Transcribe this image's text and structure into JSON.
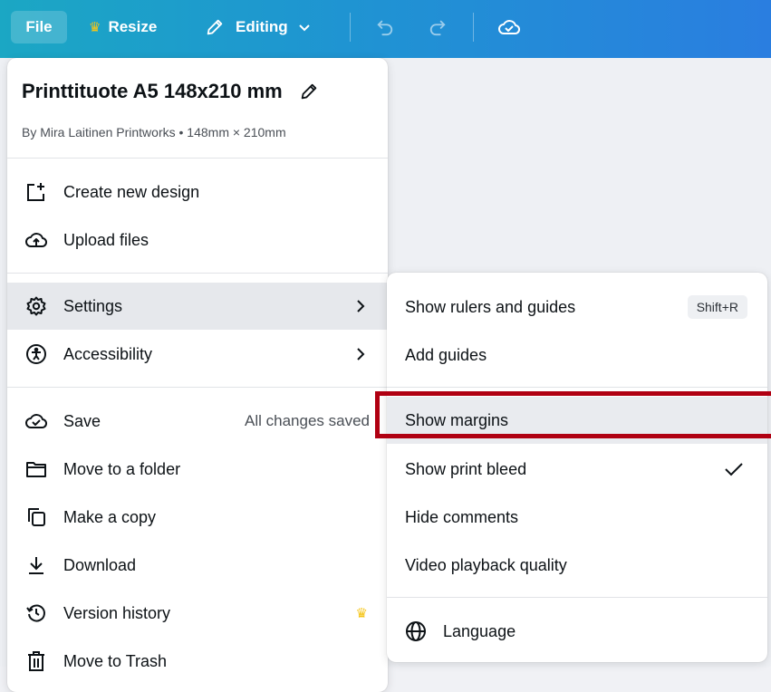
{
  "topbar": {
    "file_label": "File",
    "resize_label": "Resize",
    "editing_label": "Editing",
    "icons": [
      "crown-icon",
      "pencil-icon",
      "chevron-down-icon",
      "undo-icon",
      "redo-icon",
      "cloud-check-icon"
    ]
  },
  "menu": {
    "title": "Printtituote A5 148x210 mm",
    "subtitle": "By Mira Laitinen Printworks • 148mm × 210mm",
    "items": [
      {
        "label": "Create new design",
        "icon": "add-design-icon"
      },
      {
        "label": "Upload files",
        "icon": "cloud-upload-icon"
      },
      {
        "label": "Settings",
        "icon": "gear-icon",
        "has_submenu": true,
        "active": true
      },
      {
        "label": "Accessibility",
        "icon": "accessibility-icon",
        "has_submenu": true
      },
      {
        "label": "Save",
        "icon": "cloud-check-icon",
        "status": "All changes saved"
      },
      {
        "label": "Move to a folder",
        "icon": "folder-icon"
      },
      {
        "label": "Make a copy",
        "icon": "copy-icon"
      },
      {
        "label": "Download",
        "icon": "download-icon"
      },
      {
        "label": "Version history",
        "icon": "history-icon",
        "premium": true
      },
      {
        "label": "Move to Trash",
        "icon": "trash-icon"
      }
    ]
  },
  "submenu": {
    "items": [
      {
        "label": "Show rulers and guides",
        "shortcut": "Shift+R"
      },
      {
        "label": "Add guides"
      },
      {
        "label": "Show margins",
        "highlighted": true
      },
      {
        "label": "Show print bleed",
        "checked": true
      },
      {
        "label": "Hide comments"
      },
      {
        "label": "Video playback quality"
      },
      {
        "label": "Language",
        "icon": "globe-icon"
      }
    ]
  },
  "colors": {
    "topbar_start": "#1ba7c4",
    "topbar_end": "#2a7ee0",
    "crown": "#f5c518",
    "highlight_box": "#b00012",
    "active_row": "#e6e8ec"
  }
}
